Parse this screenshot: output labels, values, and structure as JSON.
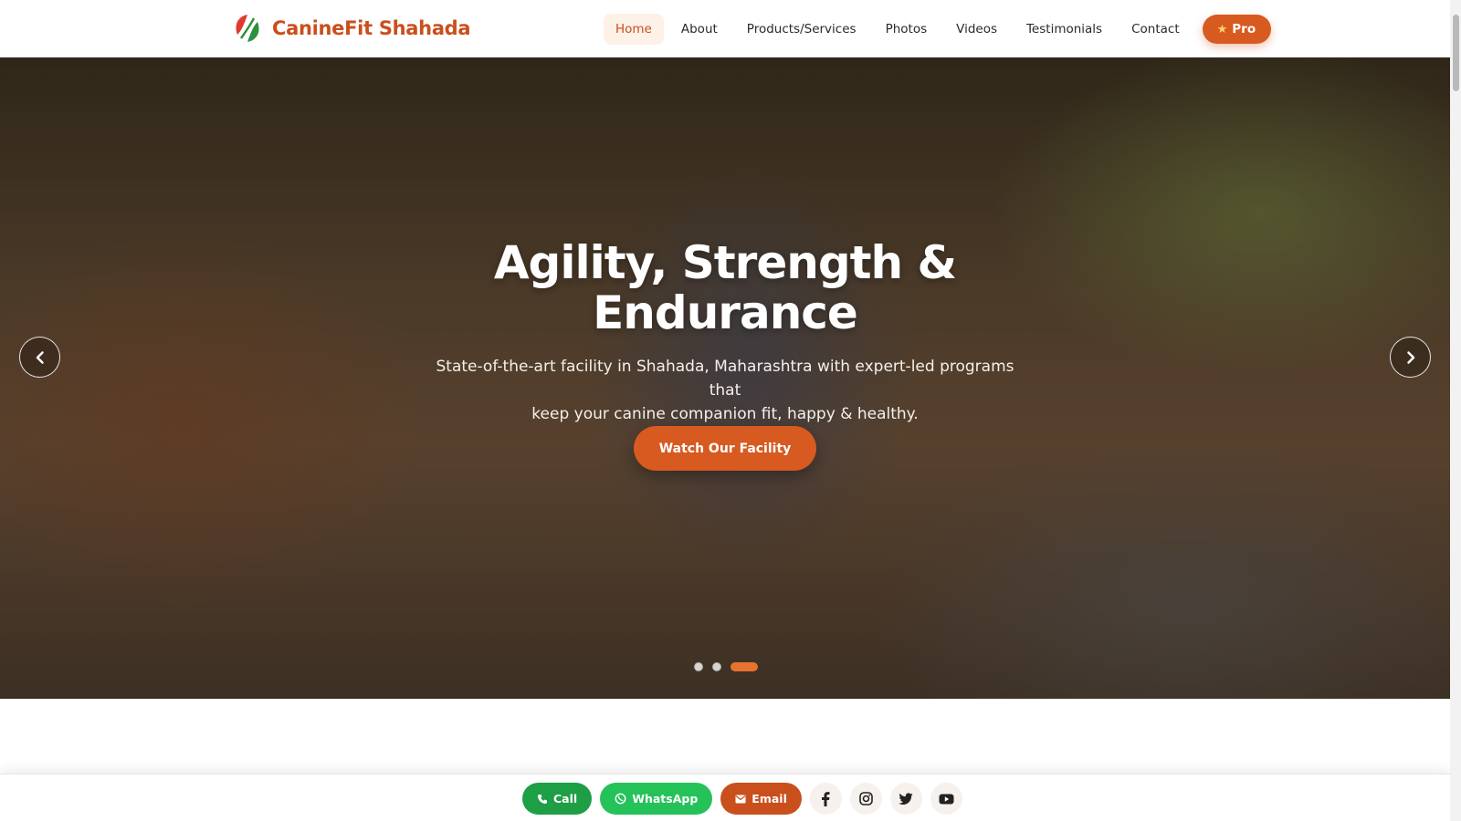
{
  "brand": {
    "name": "CanineFit Shahada",
    "logo_icon": "leaf-logo-icon"
  },
  "nav": {
    "items": [
      {
        "label": "Home",
        "active": true
      },
      {
        "label": "About"
      },
      {
        "label": "Products/Services"
      },
      {
        "label": "Photos"
      },
      {
        "label": "Videos"
      },
      {
        "label": "Testimonials"
      },
      {
        "label": "Contact"
      }
    ],
    "pro_label": "Pro"
  },
  "hero": {
    "title_line1": "Agility, Strength &",
    "title_line2": "Endurance",
    "subtitle_line1": "State-of-the-art facility in Shahada, Maharashtra with expert-led programs that",
    "subtitle_line2": "keep your canine companion fit, happy & healthy.",
    "cta_label": "Watch Our Facility",
    "slides_total": 3,
    "active_slide": 3
  },
  "bottom_bar": {
    "call_label": "Call",
    "whatsapp_label": "WhatsApp",
    "email_label": "Email",
    "socials": [
      "facebook-icon",
      "instagram-icon",
      "twitter-icon",
      "youtube-icon"
    ]
  },
  "colors": {
    "accent": "#d75a20",
    "brand_text": "#c94f1d",
    "call_green": "#1e9e45",
    "whatsapp_green": "#25c25a"
  }
}
